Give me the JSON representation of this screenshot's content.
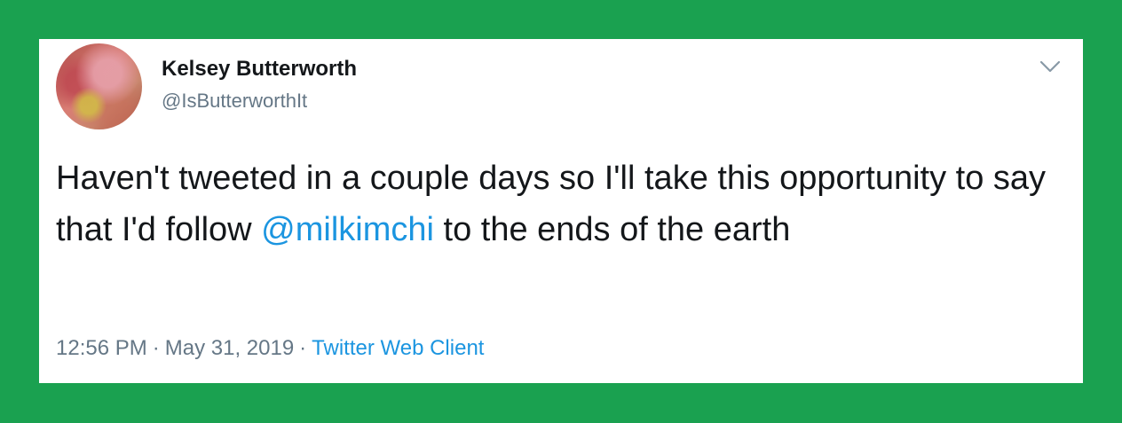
{
  "tweet": {
    "author_name": "Kelsey Butterworth",
    "author_handle": "@IsButterworthIt",
    "text_before": "Haven't tweeted in a couple days so I'll take this opportunity to say that I'd follow ",
    "mention": "@milkimchi",
    "text_after": " to the ends of the earth",
    "time": "12:56 PM",
    "separator": "·",
    "date": "May 31, 2019",
    "client": "Twitter Web Client"
  },
  "icons": {
    "menu": "chevron-down-icon"
  },
  "colors": {
    "background": "#1aa150",
    "card": "#ffffff",
    "text": "#14171a",
    "secondary": "#657786",
    "link": "#1b95e0"
  }
}
